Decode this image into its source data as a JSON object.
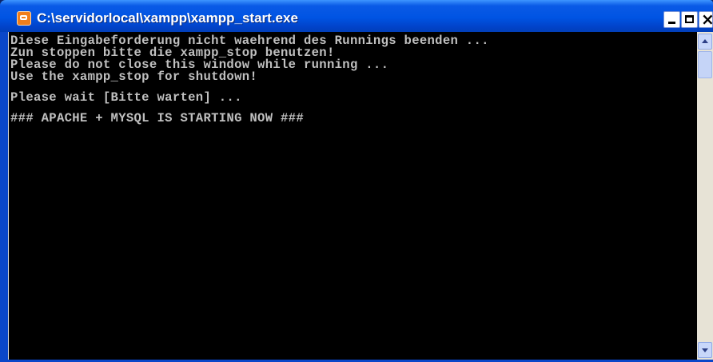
{
  "window": {
    "title": "C:\\servidorlocal\\xampp\\xampp_start.exe",
    "icon": "xampp-app-icon"
  },
  "console": {
    "lines": [
      "Diese Eingabeforderung nicht waehrend des Runnings beenden ...",
      "Zun stoppen bitte die xampp_stop benutzen!",
      "Please do not close this window while running ...",
      "Use the xampp_stop for shutdown!",
      "",
      "Please wait [Bitte warten] ...",
      "",
      "### APACHE + MYSQL IS STARTING NOW ###"
    ]
  },
  "colors": {
    "titlebar": "#0054e3",
    "console_background": "#000000",
    "console_text": "#c0c0c0"
  }
}
